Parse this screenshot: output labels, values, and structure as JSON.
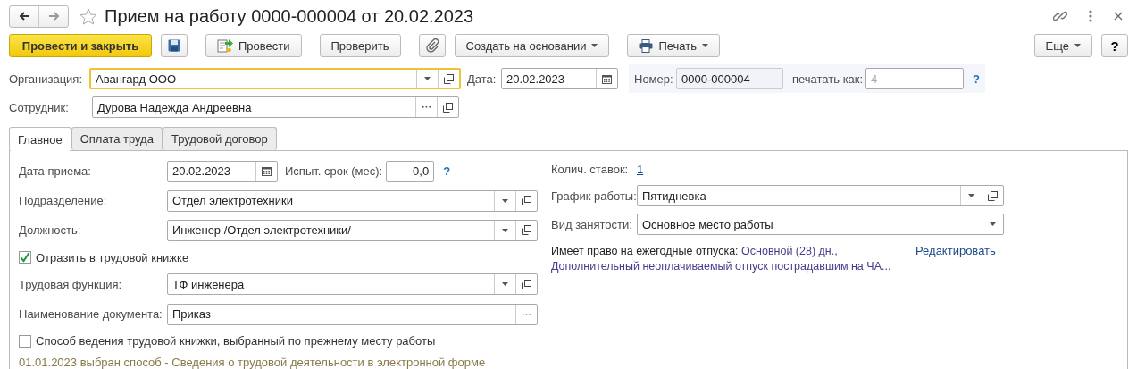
{
  "window": {
    "title": "Прием на работу 0000-000004 от 20.02.2023",
    "favorite": false
  },
  "toolbar": [
    {
      "kind": "primary",
      "label": "Провести и закрыть"
    },
    {
      "kind": "save"
    },
    {
      "kind": "post",
      "label": "Провести"
    },
    {
      "kind": "text",
      "label": "Проверить"
    },
    {
      "kind": "attach"
    },
    {
      "kind": "menu",
      "label": "Создать на основании"
    },
    {
      "kind": "print",
      "label": "Печать"
    }
  ],
  "toolbar_right": [
    {
      "kind": "menu",
      "label": "Еще"
    },
    {
      "kind": "help",
      "label": "?"
    }
  ],
  "header": {
    "organization": {
      "label": "Организация:",
      "value": "Авангард ООО",
      "focused": true
    },
    "date": {
      "label": "Дата:",
      "value": "20.02.2023"
    },
    "number": {
      "label": "Номер:",
      "value": "0000-000004"
    },
    "print_as": {
      "label": "печатать как:",
      "placeholder": "4",
      "help": "?"
    },
    "employee": {
      "label": "Сотрудник:",
      "value": "Дурова Надежда Андреевна"
    }
  },
  "tabs": [
    {
      "label": "Главное",
      "selected": true
    },
    {
      "label": "Оплата труда",
      "selected": false
    },
    {
      "label": "Трудовой договор",
      "selected": false
    }
  ],
  "left": [
    {
      "kind": "date",
      "label": "Дата приема:",
      "value": "20.02.2023",
      "probation": {
        "label": "Испыт. срок (мес):",
        "value": "0,0",
        "help": "?"
      }
    },
    {
      "kind": "select",
      "label": "Подразделение:",
      "value": "Отдел электротехники"
    },
    {
      "kind": "select",
      "label": "Должность:",
      "value": "Инженер /Отдел электротехники/"
    },
    {
      "kind": "checkbox",
      "label": "Отразить в трудовой книжке",
      "checked": true
    },
    {
      "kind": "select",
      "label": "Трудовая функция:",
      "value": "ТФ инженера"
    },
    {
      "kind": "choice",
      "label": "Наименование документа:",
      "value": "Приказ"
    },
    {
      "kind": "checkbox",
      "label": "Способ ведения трудовой книжки, выбранный по прежнему месту работы",
      "checked": false
    },
    {
      "kind": "note",
      "text": "01.01.2023 выбран способ - Сведения о трудовой деятельности в электронной форме"
    }
  ],
  "right": [
    {
      "kind": "link",
      "label": "Колич. ставок:",
      "value": "1"
    },
    {
      "kind": "select",
      "label": "График работы:",
      "value": "Пятидневка"
    },
    {
      "kind": "dropdown",
      "label": "Вид занятости:",
      "value": "Основное место работы"
    },
    {
      "kind": "vacations",
      "label": "Имеет право на ежегодные отпуска:",
      "items": [
        "Основной (28) дн.,",
        "Дополнительный неоплачиваемый отпуск пострадавшим на ЧА..."
      ],
      "action": "Редактировать"
    }
  ]
}
